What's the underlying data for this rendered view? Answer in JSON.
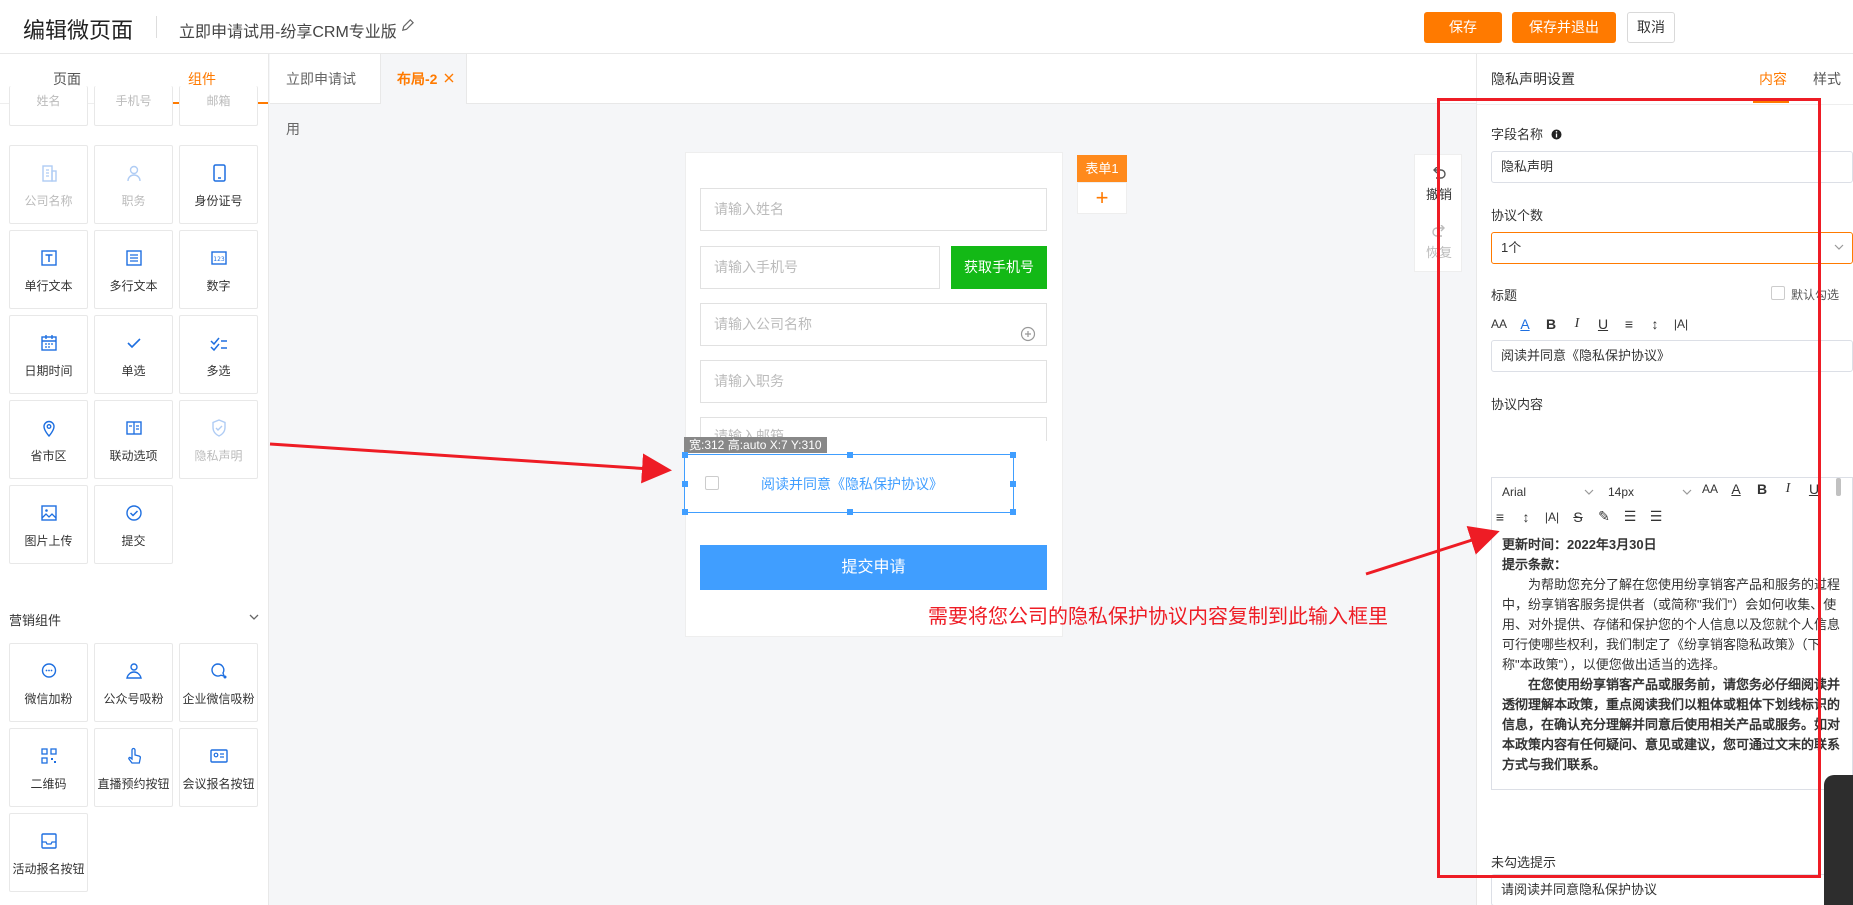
{
  "header": {
    "title": "编辑微页面",
    "subtitle": "立即申请试用-纷享CRM专业版",
    "save": "保存",
    "save_exit": "保存并退出",
    "cancel": "取消"
  },
  "left_tabs": [
    "页面",
    "组件"
  ],
  "components": {
    "cut_row": [
      "姓名",
      "手机号",
      "邮箱"
    ],
    "basic": [
      "公司名称",
      "职务",
      "身份证号",
      "单行文本",
      "多行文本",
      "数字",
      "日期时间",
      "单选",
      "多选",
      "省市区",
      "联动选项",
      "隐私声明",
      "图片上传",
      "提交"
    ],
    "marketing_title": "营销组件",
    "marketing": [
      "微信加粉",
      "公众号吸粉",
      "企业微信吸粉",
      "二维码",
      "直播预约按钮",
      "会议报名按钮",
      "活动报名按钮"
    ]
  },
  "canvas_tabs": [
    "立即申请试用",
    "布局-2"
  ],
  "form": {
    "name_placeholder": "请输入姓名",
    "phone_placeholder": "请输入手机号",
    "get_phone": "获取手机号",
    "company_placeholder": "请输入公司名称",
    "position_placeholder": "请输入职务",
    "email_placeholder": "请输入邮箱",
    "size_tag": "宽:312 高:auto X:7 Y:310",
    "agree_text": "阅读并同意《隐私保护协议》",
    "submit": "提交申请",
    "tag": "表单1",
    "add": "+"
  },
  "history": {
    "undo": "撤销",
    "redo": "恢复"
  },
  "right_panel": {
    "title": "隐私声明设置",
    "tab_content": "内容",
    "tab_style": "样式",
    "field_name_label": "字段名称",
    "field_name_value": "隐私声明",
    "count_label": "协议个数",
    "count_value": "1个",
    "heading_label": "标题",
    "default_checked": "默认勾选",
    "heading_value": "阅读并同意《隐私保护协议》",
    "content_label": "协议内容",
    "font_family": "Arial",
    "font_size": "14px",
    "content": {
      "update": "更新时间：2022年3月30日",
      "tip": "提示条款：",
      "para1": "为帮助您充分了解在您使用纷享销客产品和服务的过程中，纷享销客服务提供者（或简称\"我们\"）会如何收集、使用、对外提供、存储和保护您的个人信息以及您就个人信息可行使哪些权利，我们制定了《纷享销客隐私政策》（下称\"本政策\"），以便您做出适当的选择。",
      "para2": "在您使用纷享销客产品或服务前，请您务必仔细阅读并透彻理解本政策，重点阅读我们以粗体或粗体下划线标识的信息，在确认充分理解并同意后使用相关产品或服务。如对本政策内容有任何疑问、意见或建议，您可通过文末的联系方式与我们联系。"
    },
    "unchecked_label": "未勾选提示",
    "unchecked_value": "请阅读并同意隐私保护协议"
  },
  "annotation": "需要将您公司的隐私保护协议内容复制到此输入框里",
  "colors": {
    "accent": "#ff7a00",
    "primary": "#409eff",
    "green": "#13b916",
    "annotation": "#ee1c25"
  }
}
